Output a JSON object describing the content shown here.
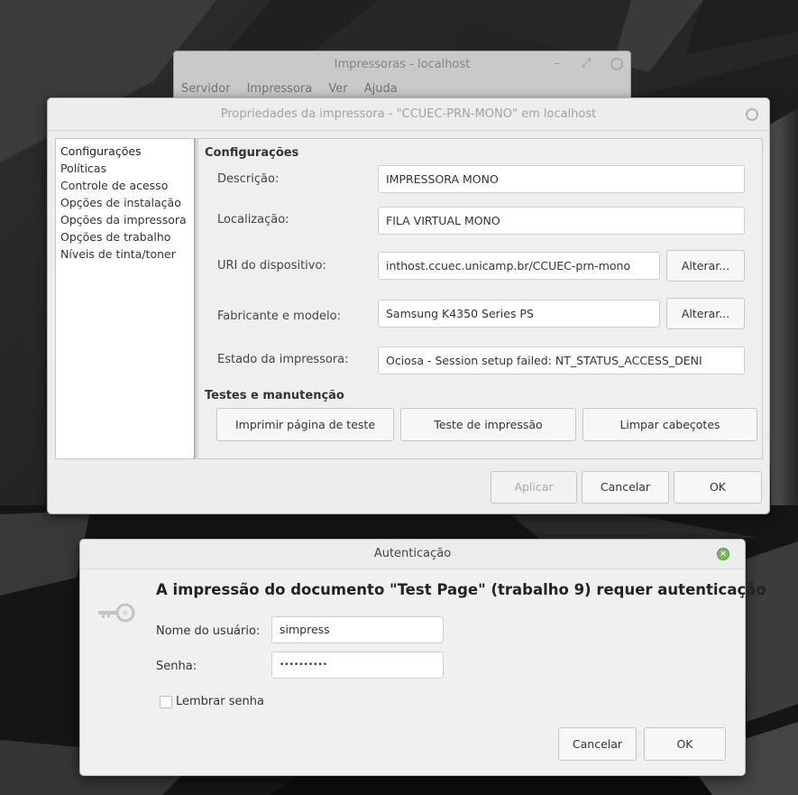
{
  "printers_window": {
    "title": "Impressoras - localhost",
    "menu": [
      "Servidor",
      "Impressora",
      "Ver",
      "Ajuda"
    ]
  },
  "properties_window": {
    "title": "Propriedades da impressora - \"CCUEC-PRN-MONO\" em localhost",
    "sidebar_items": [
      "Configurações",
      "Políticas",
      "Controle de acesso",
      "Opções de instalação",
      "Opções da impressora",
      "Opções de trabalho",
      "Níveis de tinta/toner"
    ],
    "section_settings": "Configurações",
    "fields": {
      "description": {
        "label": "Descrição:",
        "value": "IMPRESSORA MONO"
      },
      "location": {
        "label": "Localização:",
        "value": "FILA VIRTUAL MONO"
      },
      "device_uri": {
        "label": "URI do dispositivo:",
        "value": "inthost.ccuec.unicamp.br/CCUEC-prn-mono",
        "button": "Alterar..."
      },
      "make_model": {
        "label": "Fabricante e modelo:",
        "value": "Samsung K4350 Series PS",
        "button": "Alterar..."
      },
      "printer_state": {
        "label": "Estado da impressora:",
        "value": "Ociosa - Session setup failed: NT_STATUS_ACCESS_DENI"
      }
    },
    "section_maintenance": "Testes e manutenção",
    "maintenance_buttons": {
      "print_test_page": "Imprimir página de teste",
      "print_test": "Teste de impressão",
      "clean_heads": "Limpar cabeçotes"
    },
    "dialog_buttons": {
      "apply": "Aplicar",
      "cancel": "Cancelar",
      "ok": "OK"
    }
  },
  "auth_dialog": {
    "title": "Autenticação",
    "heading": "A impressão do documento \"Test Page\" (trabalho 9) requer autenticação",
    "username_label": "Nome do usuário:",
    "username_value": "simpress",
    "password_label": "Senha:",
    "password_value": "••••••••••",
    "remember_label": "Lembrar senha",
    "remember_checked": false,
    "cancel": "Cancelar",
    "ok": "OK"
  },
  "colors": {
    "close_button_active": "#7bb661",
    "desktop_background": "#141414"
  }
}
